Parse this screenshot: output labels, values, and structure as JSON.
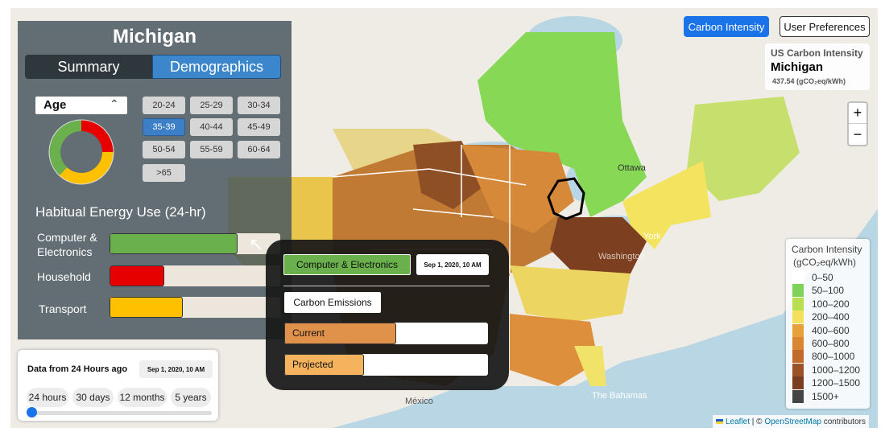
{
  "header": {
    "carbon_btn": "Carbon Intensity",
    "prefs_btn": "User Preferences"
  },
  "info": {
    "title": "US Carbon Intensity",
    "state": "Michigan",
    "value": "437.54 (gCO₂eq/kWh)"
  },
  "zoom": {
    "in": "+",
    "out": "−"
  },
  "panel": {
    "state": "Michigan",
    "tabs": [
      "Summary",
      "Demographics"
    ],
    "selector": "Age",
    "age_groups": [
      "20-24",
      "25-29",
      "30-34",
      "35-39",
      "40-44",
      "45-49",
      "50-54",
      "55-59",
      "60-64",
      ">65"
    ],
    "selected_age": "35-39",
    "energy_title": "Habitual Energy Use (24-hr)",
    "bars": [
      {
        "label": "Computer &\nElectronics",
        "value": 0.75,
        "color": "#6ab04c"
      },
      {
        "label": "Household",
        "value": 0.32,
        "color": "#e60000"
      },
      {
        "label": "Transport",
        "value": 0.43,
        "color": "#ffc000"
      }
    ],
    "donut": [
      {
        "color": "#e60000",
        "value": 0.25
      },
      {
        "color": "#ffc000",
        "value": 0.37
      },
      {
        "color": "#6ab04c",
        "value": 0.38
      }
    ]
  },
  "popup": {
    "category": "Computer & Electronics",
    "timestamp": "Sep 1, 2020, 10 AM",
    "section": "Carbon Emissions",
    "current_label": "Current",
    "current_value": 0.55,
    "current_color": "#e0914a",
    "projected_label": "Projected",
    "projected_value": 0.39,
    "projected_color": "#f6b35d"
  },
  "timebox": {
    "title": "Data from 24 Hours ago",
    "timestamp": "Sep 1, 2020, 10 AM",
    "options": [
      "24 hours",
      "30 days",
      "12 months",
      "5 years"
    ],
    "slider_value": 0
  },
  "legend": {
    "title": "Carbon Intensity",
    "unit": "(gCO₂eq/kWh)",
    "items": [
      {
        "label": "0–50",
        "color": "#ffffff"
      },
      {
        "label": "50–100",
        "color": "#7fd35b"
      },
      {
        "label": "100–200",
        "color": "#b7df50"
      },
      {
        "label": "200–400",
        "color": "#f4e05d"
      },
      {
        "label": "400–600",
        "color": "#e8a13a"
      },
      {
        "label": "600–800",
        "color": "#d98531"
      },
      {
        "label": "800–1000",
        "color": "#c26a2c"
      },
      {
        "label": "1000–1200",
        "color": "#9c5227"
      },
      {
        "label": "1200–1500",
        "color": "#7a3d1f"
      },
      {
        "label": "1500+",
        "color": "#444444"
      }
    ]
  },
  "map_labels": {
    "ottawa": "Ottawa",
    "newyork": "York",
    "washington": "Washington",
    "mexico": "México",
    "bahamas": "The Bahamas"
  },
  "attribution": {
    "leaflet": "Leaflet",
    "sep": " | © ",
    "osm": "OpenStreetMap",
    "suffix": " contributors"
  }
}
